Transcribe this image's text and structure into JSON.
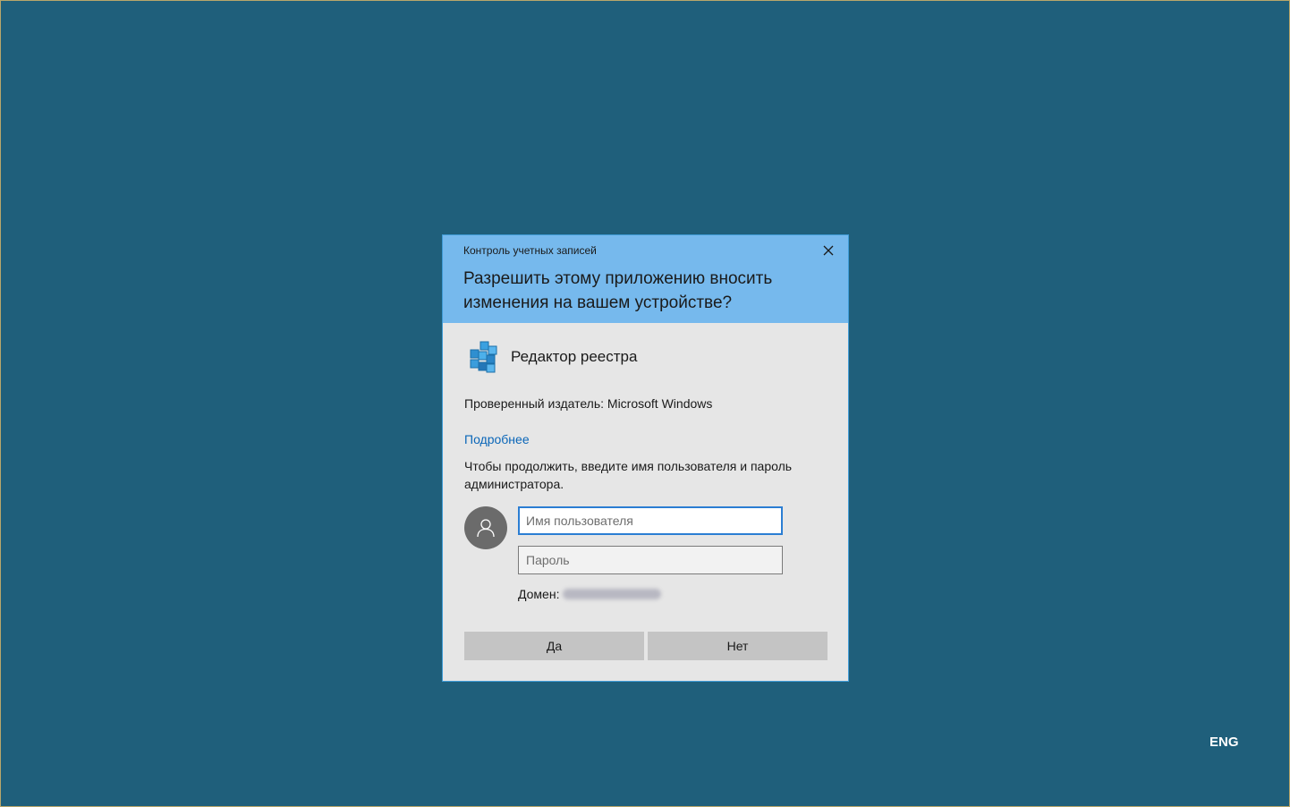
{
  "dialog": {
    "header_title": "Контроль учетных записей",
    "question": "Разрешить этому приложению вносить изменения на вашем устройстве?",
    "app_name": "Редактор реестра",
    "publisher": "Проверенный издатель: Microsoft Windows",
    "details_link": "Подробнее",
    "instruction": "Чтобы продолжить, введите имя пользователя и пароль администратора.",
    "username_placeholder": "Имя пользователя",
    "username_value": "",
    "password_placeholder": "Пароль",
    "password_value": "",
    "domain_label": "Домен:",
    "domain_value": "",
    "yes_label": "Да",
    "no_label": "Нет"
  },
  "taskbar": {
    "language": "ENG"
  },
  "colors": {
    "desktop_background": "#1f5f7b",
    "header_background": "#76b9ed",
    "dialog_background": "#e6e6e6",
    "link": "#0a66b8",
    "button": "#c4c4c4"
  },
  "icons": {
    "close": "close-icon",
    "app": "registry-editor-icon",
    "avatar": "user-avatar-icon"
  }
}
